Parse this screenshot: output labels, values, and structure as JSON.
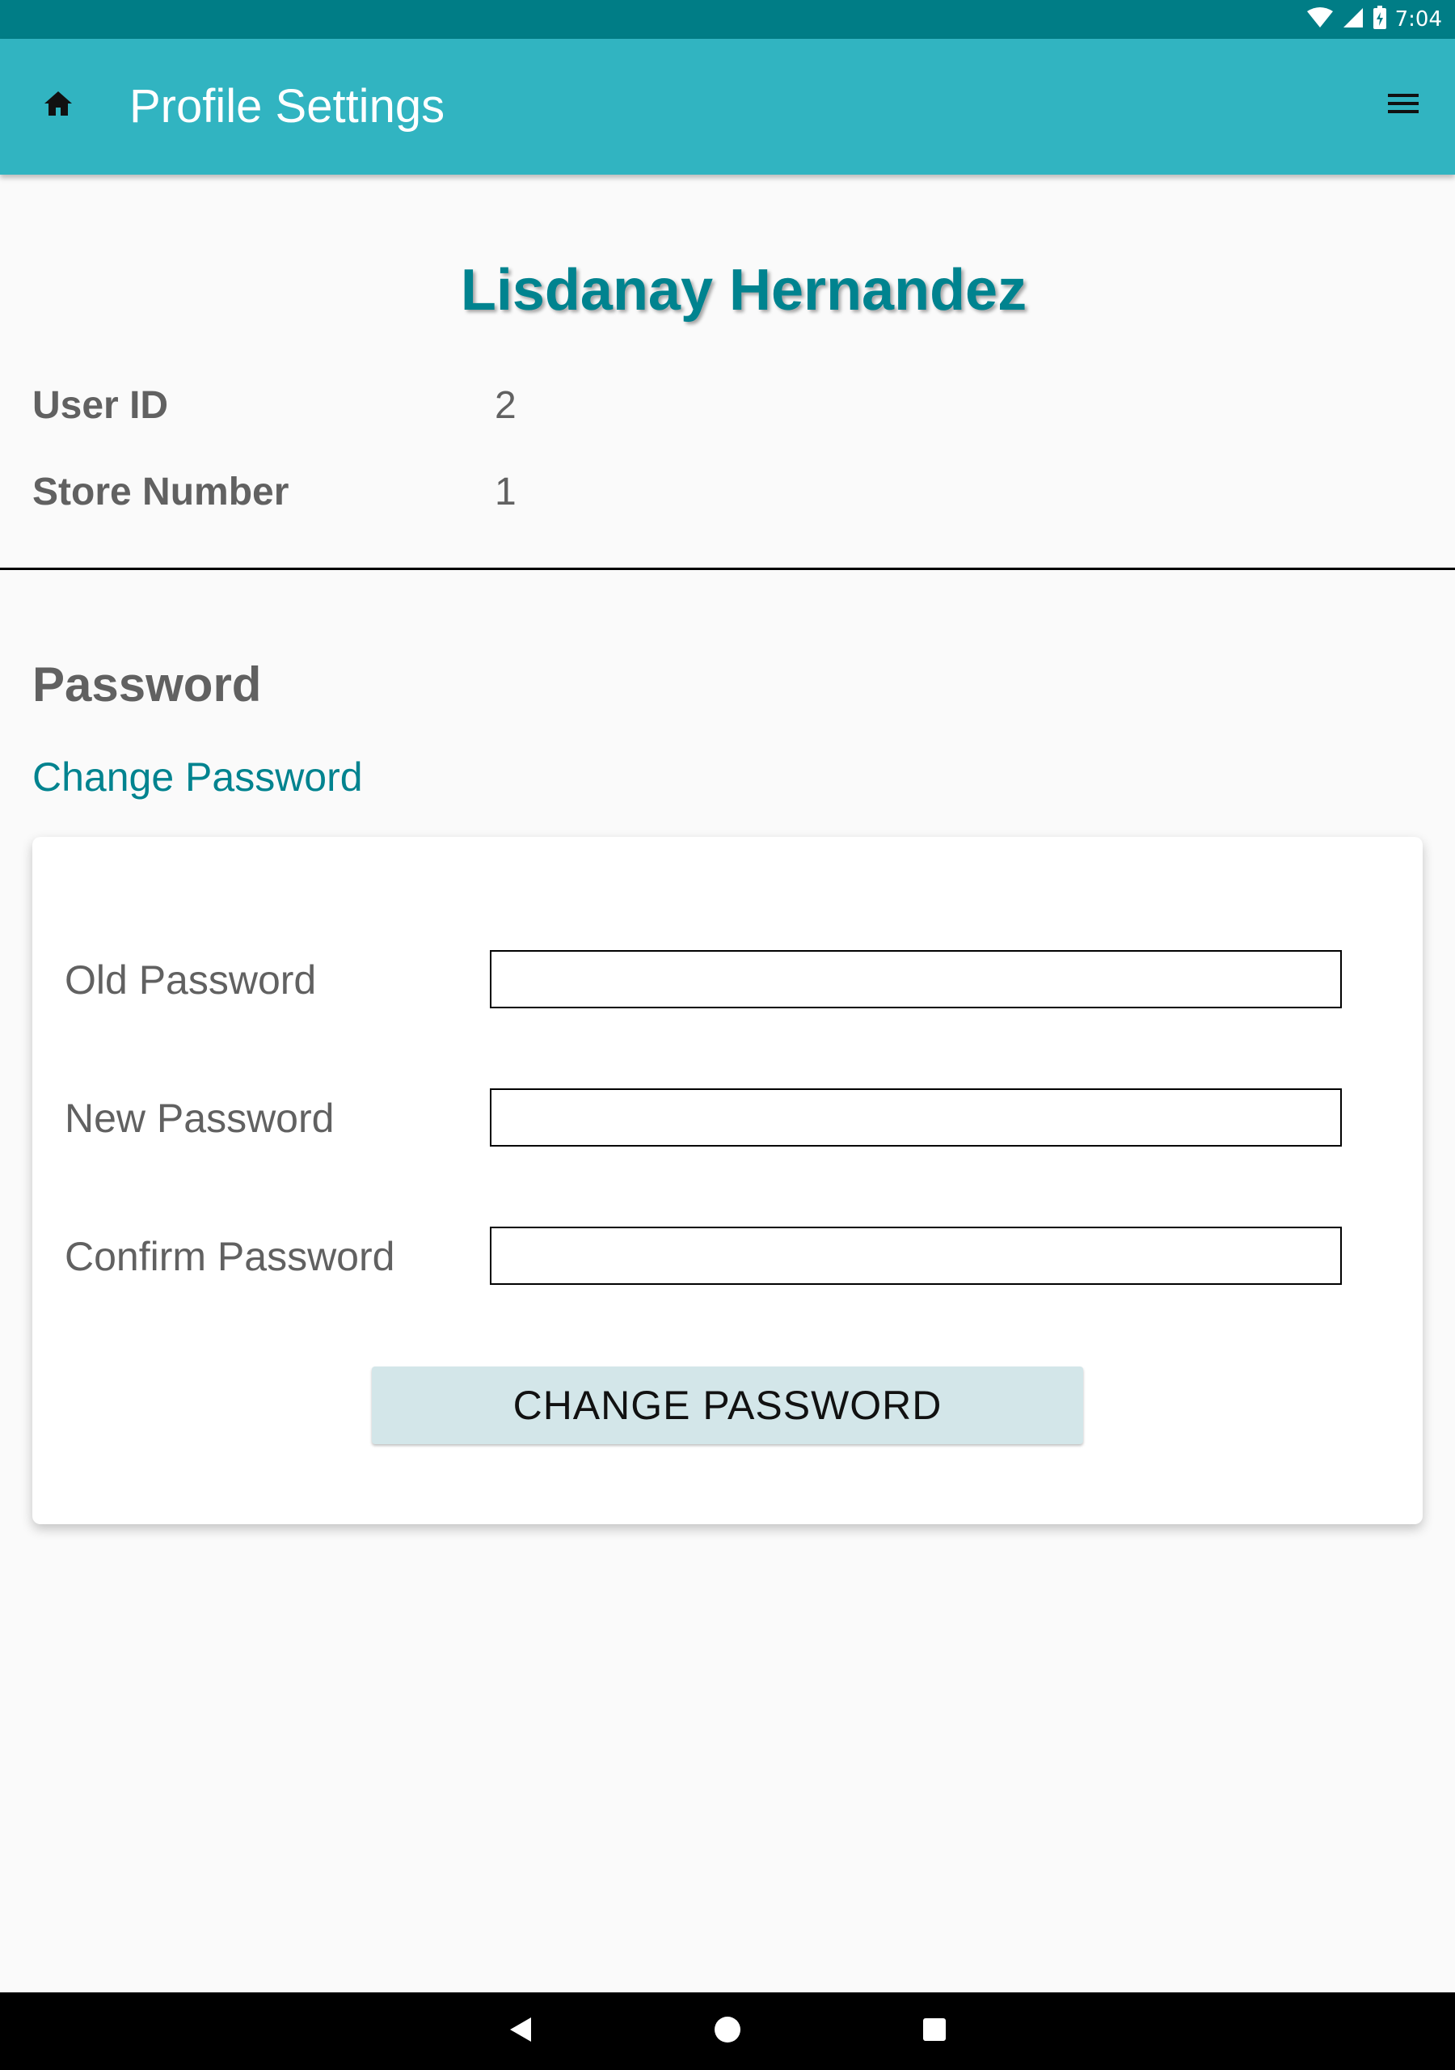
{
  "status_bar": {
    "time": "7:04",
    "icons": [
      "wifi-icon",
      "cellular-signal-icon",
      "battery-charging-icon"
    ]
  },
  "app_bar": {
    "title": "Profile Settings",
    "home_icon": "home-icon",
    "menu_icon": "hamburger-menu-icon"
  },
  "profile": {
    "name": "Lisdanay Hernandez",
    "fields": [
      {
        "label": "User ID",
        "value": "2"
      },
      {
        "label": "Store Number",
        "value": "1"
      }
    ]
  },
  "password_section": {
    "title": "Password",
    "link": "Change Password",
    "form": {
      "fields": [
        {
          "label": "Old Password",
          "value": ""
        },
        {
          "label": "New Password",
          "value": ""
        },
        {
          "label": "Confirm Password",
          "value": ""
        }
      ],
      "submit_label": "CHANGE PASSWORD"
    }
  },
  "nav_bar": {
    "buttons": [
      "back-icon",
      "home-circle-icon",
      "recents-square-icon"
    ]
  },
  "colors": {
    "status_bar": "#007d86",
    "app_bar": "#31b4c1",
    "accent": "#00838f",
    "button_bg": "#d3e6e9",
    "text_gray": "#616161"
  }
}
